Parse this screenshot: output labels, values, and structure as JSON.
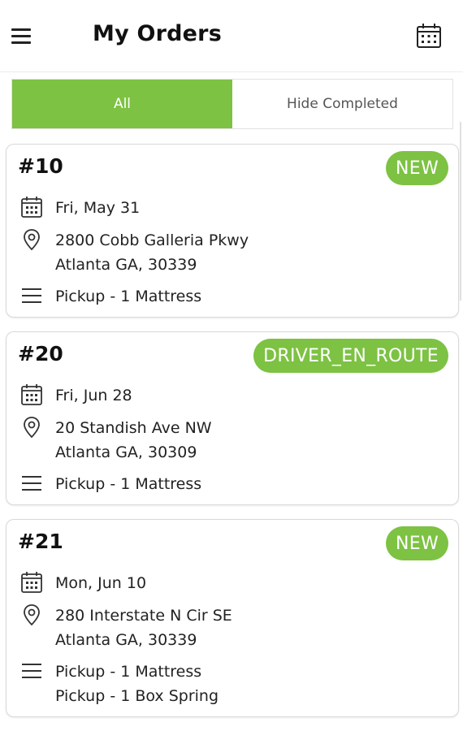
{
  "header": {
    "title": "My Orders",
    "menu_icon": "hamburger-menu-icon",
    "calendar_icon": "calendar-icon"
  },
  "tabs": [
    {
      "label": "All",
      "active": true
    },
    {
      "label": "Hide Completed",
      "active": false
    }
  ],
  "colors": {
    "accent": "#7dc243",
    "text": "#222222"
  },
  "orders": [
    {
      "id": "#10",
      "status": "NEW",
      "date": "Fri, May 31",
      "address_line1": "2800 Cobb Galleria Pkwy",
      "address_line2": "Atlanta GA, 30339",
      "items": [
        "Pickup - 1 Mattress"
      ]
    },
    {
      "id": "#20",
      "status": "DRIVER_EN_ROUTE",
      "date": "Fri, Jun 28",
      "address_line1": "20 Standish Ave NW",
      "address_line2": "Atlanta GA, 30309",
      "items": [
        "Pickup - 1 Mattress"
      ]
    },
    {
      "id": "#21",
      "status": "NEW",
      "date": "Mon, Jun 10",
      "address_line1": "280 Interstate N Cir SE",
      "address_line2": "Atlanta GA, 30339",
      "items": [
        "Pickup - 1 Mattress",
        "Pickup - 1 Box Spring"
      ]
    }
  ]
}
